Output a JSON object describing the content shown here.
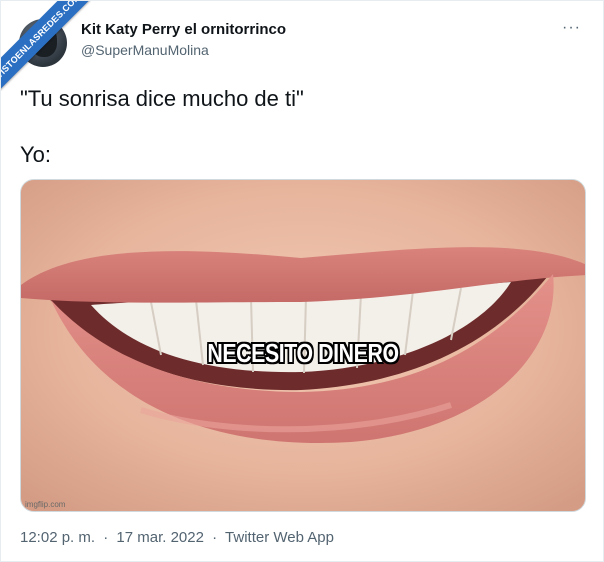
{
  "watermark": {
    "text": "VISTOENLASREDES.COM"
  },
  "author": {
    "display_name": "Kit Katy Perry el ornitorrinco",
    "handle": "@SuperManuMolina",
    "more_label": "···"
  },
  "tweet": {
    "line1": "\"Tu sonrisa dice mucho de ti\"",
    "line2": "Yo:"
  },
  "media": {
    "caption": "NECESITO DINERO",
    "source_mark": "imgflip.com"
  },
  "meta": {
    "time": "12:02 p. m.",
    "sep1": "·",
    "date": "17 mar. 2022",
    "sep2": "·",
    "app": "Twitter Web App"
  }
}
